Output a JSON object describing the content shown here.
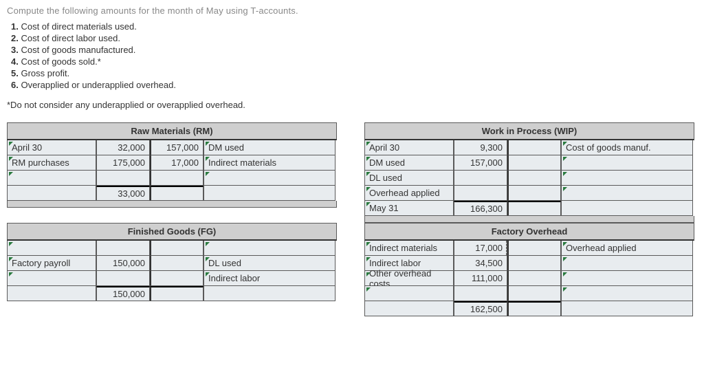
{
  "intro": "Compute the following amounts for the month of May using T-accounts.",
  "items": [
    "Cost of direct materials used.",
    "Cost of direct labor used.",
    "Cost of goods manufactured.",
    "Cost of goods sold.*",
    "Gross profit.",
    "Overapplied or underapplied overhead."
  ],
  "note": "*Do not consider any underapplied or overapplied overhead.",
  "rm": {
    "title": "Raw Materials (RM)",
    "r1": {
      "lab": "April 30",
      "deb": "32,000",
      "cred": "157,000",
      "desc": "DM used"
    },
    "r2": {
      "lab": "RM purchases",
      "deb": "175,000",
      "cred": "17,000",
      "desc": "Indirect materials"
    },
    "tot": {
      "deb": "33,000"
    }
  },
  "wip": {
    "title": "Work in Process (WIP)",
    "r1": {
      "lab": "April 30",
      "deb": "9,300",
      "desc": "Cost of goods manuf."
    },
    "r2": {
      "lab": "DM used",
      "deb": "157,000"
    },
    "r3": {
      "lab": "DL used"
    },
    "r4": {
      "lab": "Overhead applied"
    },
    "r5": {
      "lab": "May 31",
      "deb": "166,300"
    }
  },
  "fg": {
    "title": "Finished Goods (FG)",
    "r2": {
      "lab": "Factory payroll",
      "deb": "150,000",
      "desc": "DL used"
    },
    "r3": {
      "desc": "Indirect labor"
    },
    "tot": {
      "deb": "150,000"
    }
  },
  "oh": {
    "title": "Factory Overhead",
    "r1": {
      "lab": "Indirect materials",
      "deb": "17,000",
      "desc": "Overhead applied"
    },
    "r2": {
      "lab": "Indirect labor",
      "deb": "34,500"
    },
    "r3": {
      "lab": "Other overhead costs",
      "deb": "111,000"
    },
    "tot": {
      "deb": "162,500"
    }
  }
}
